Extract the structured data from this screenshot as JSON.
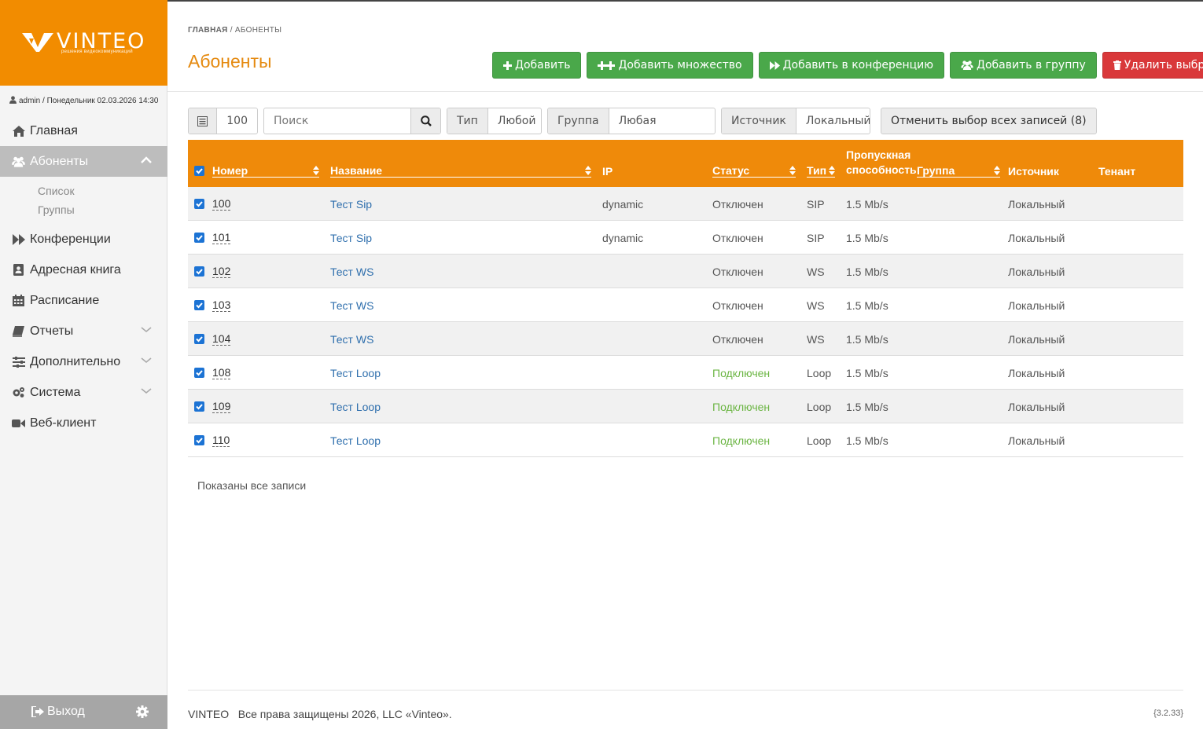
{
  "brand": {
    "logo_text": "VINTEO",
    "logo_subtitle": "решения видеокоммуникаций",
    "accent": "#f28c00"
  },
  "user": {
    "line": "admin / Понедельник 02.03.2026 14:30"
  },
  "sidebar": {
    "items": [
      {
        "label": "Главная",
        "icon": "home-icon"
      },
      {
        "label": "Абоненты",
        "icon": "users-icon",
        "active": true
      },
      {
        "label": "Конференции",
        "icon": "fast-forward-icon"
      },
      {
        "label": "Адресная книга",
        "icon": "address-book-icon"
      },
      {
        "label": "Расписание",
        "icon": "calendar-icon"
      },
      {
        "label": "Отчеты",
        "icon": "book-icon"
      },
      {
        "label": "Дополнительно",
        "icon": "sliders-icon"
      },
      {
        "label": "Система",
        "icon": "cogs-icon"
      },
      {
        "label": "Веб-клиент",
        "icon": "video-camera-icon"
      }
    ],
    "subitems": [
      "Список",
      "Группы"
    ],
    "logout_label": "Выход"
  },
  "breadcrumb": {
    "home": "ГЛАВНАЯ",
    "separator": "/",
    "current": "АБОНЕНТЫ"
  },
  "page_title": "Абоненты",
  "actions": {
    "add": "Добавить",
    "add_many": "Добавить множество",
    "add_to_conference": "Добавить в конференцию",
    "add_to_group": "Добавить в группу",
    "delete_selected": "Удалить выбранные"
  },
  "toolbar": {
    "page_size": "100",
    "search_placeholder": "Поиск",
    "type_label": "Тип",
    "type_value": "Любой",
    "group_label": "Группа",
    "group_value": "Любая",
    "source_label": "Источник",
    "source_value": "Локальный",
    "unselect_all": "Отменить выбор всех записей (8)"
  },
  "table": {
    "headers": {
      "number": "Номер",
      "name": "Название",
      "ip": "IP",
      "status": "Статус",
      "type": "Тип",
      "bandwidth_1": "Пропускная",
      "bandwidth_2": "способность",
      "group": "Группа",
      "source": "Источник",
      "tenant": "Тенант"
    },
    "rows": [
      {
        "number": "100",
        "name": "Тест Sip",
        "ip": "dynamic",
        "status": "Отключен",
        "online": false,
        "type": "SIP",
        "bandwidth": "1.5 Mb/s",
        "group": "",
        "source": "Локальный",
        "tenant": ""
      },
      {
        "number": "101",
        "name": "Тест Sip",
        "ip": "dynamic",
        "status": "Отключен",
        "online": false,
        "type": "SIP",
        "bandwidth": "1.5 Mb/s",
        "group": "",
        "source": "Локальный",
        "tenant": ""
      },
      {
        "number": "102",
        "name": "Тест WS",
        "ip": "",
        "status": "Отключен",
        "online": false,
        "type": "WS",
        "bandwidth": "1.5 Mb/s",
        "group": "",
        "source": "Локальный",
        "tenant": ""
      },
      {
        "number": "103",
        "name": "Тест WS",
        "ip": "",
        "status": "Отключен",
        "online": false,
        "type": "WS",
        "bandwidth": "1.5 Mb/s",
        "group": "",
        "source": "Локальный",
        "tenant": ""
      },
      {
        "number": "104",
        "name": "Тест WS",
        "ip": "",
        "status": "Отключен",
        "online": false,
        "type": "WS",
        "bandwidth": "1.5 Mb/s",
        "group": "",
        "source": "Локальный",
        "tenant": ""
      },
      {
        "number": "108",
        "name": "Тест Loop",
        "ip": "",
        "status": "Подключен",
        "online": true,
        "type": "Loop",
        "bandwidth": "1.5 Mb/s",
        "group": "",
        "source": "Локальный",
        "tenant": ""
      },
      {
        "number": "109",
        "name": "Тест Loop",
        "ip": "",
        "status": "Подключен",
        "online": true,
        "type": "Loop",
        "bandwidth": "1.5 Mb/s",
        "group": "",
        "source": "Локальный",
        "tenant": ""
      },
      {
        "number": "110",
        "name": "Тест Loop",
        "ip": "",
        "status": "Подключен",
        "online": true,
        "type": "Loop",
        "bandwidth": "1.5 Mb/s",
        "group": "",
        "source": "Локальный",
        "tenant": ""
      }
    ]
  },
  "records_info": "Показаны все записи",
  "footer": {
    "brand": "VINTEO",
    "copyright": "Все права защищены 2026, LLC «Vinteo».",
    "version": "{3.2.33}"
  },
  "colors": {
    "header_orange": "#ef8a0a",
    "title_orange": "#e58a10",
    "green_button": "#4aa84a",
    "red_button": "#d9383a",
    "link_blue": "#2f6fad",
    "online_green": "#6bb543",
    "checkbox_blue": "#1c73d4"
  }
}
